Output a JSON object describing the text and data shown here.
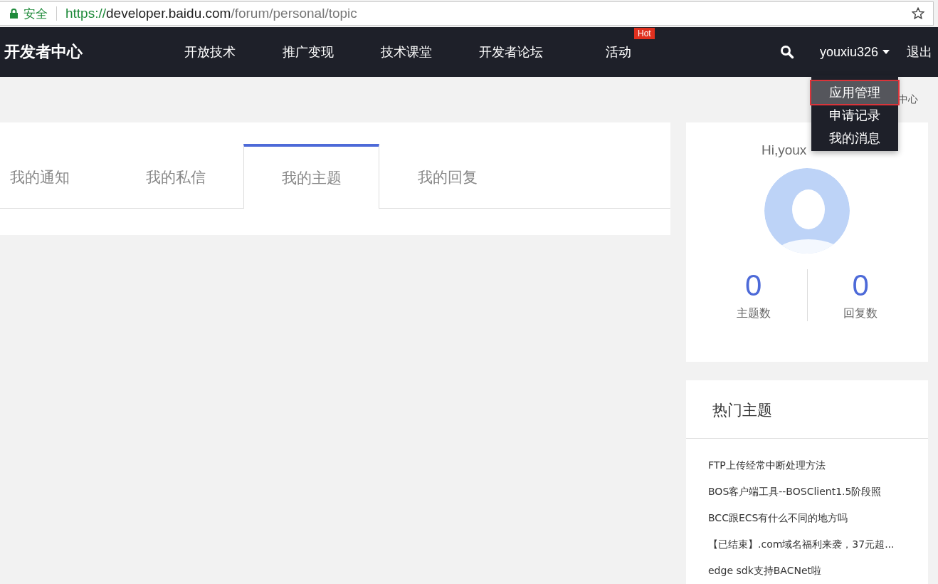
{
  "address_bar": {
    "security_label": "安全",
    "url_scheme": "https://",
    "url_host": "developer.baidu.com",
    "url_path": "/forum/personal/topic"
  },
  "nav": {
    "logo": "开发者中心",
    "items": [
      {
        "label": "开放技术"
      },
      {
        "label": "推广变现"
      },
      {
        "label": "技术课堂"
      },
      {
        "label": "开发者论坛"
      },
      {
        "label": "活动",
        "badge": "Hot"
      }
    ],
    "username": "youxiu326",
    "logout": "退出"
  },
  "user_menu": {
    "items": [
      {
        "label": "应用管理",
        "selected": true
      },
      {
        "label": "申请记录",
        "selected": false
      },
      {
        "label": "我的消息",
        "selected": false
      }
    ]
  },
  "breadcrumb_fragment": "中心",
  "tabs": [
    {
      "label": "我的通知",
      "selected": false
    },
    {
      "label": "我的私信",
      "selected": false
    },
    {
      "label": "我的主题",
      "selected": true
    },
    {
      "label": "我的回复",
      "selected": false
    }
  ],
  "profile": {
    "greeting": "Hi,youx",
    "stats": [
      {
        "value": "0",
        "label": "主题数"
      },
      {
        "value": "0",
        "label": "回复数"
      }
    ]
  },
  "hot_topics": {
    "title": "热门主题",
    "items": [
      "FTP上传经常中断处理方法",
      "BOS客户端工具--BOSClient1.5阶段照",
      "BCC跟ECS有什么不同的地方吗",
      "【已结束】.com域名福利来袭，37元超...",
      "edge sdk支持BACNet啦"
    ]
  }
}
